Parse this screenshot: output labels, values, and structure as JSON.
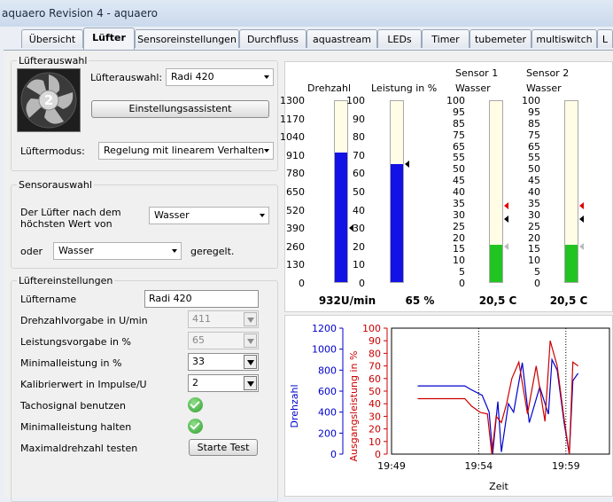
{
  "window": {
    "title": "aquaero Revision 4 -  aquaero"
  },
  "tabs": [
    {
      "label": "Übersicht"
    },
    {
      "label": "Lüfter"
    },
    {
      "label": "Sensoreinstellungen"
    },
    {
      "label": "Durchfluss"
    },
    {
      "label": "aquastream"
    },
    {
      "label": "LEDs"
    },
    {
      "label": "Timer"
    },
    {
      "label": "tubemeter"
    },
    {
      "label": "multiswitch"
    },
    {
      "label": "L"
    }
  ],
  "fan_select": {
    "title": "Lüfterauswahl",
    "fan_number": "2",
    "select_label": "Lüfterauswahl:",
    "select_value": "Radi 420",
    "wizard_button": "Einstellungsassistent",
    "mode_label": "Lüftermodus:",
    "mode_value": "Regelung mit linearem Verhalten"
  },
  "sensor_select": {
    "title": "Sensorauswahl",
    "label_line1": "Der Lüfter nach dem",
    "label_line2": "höchsten Wert von",
    "sensor1_value": "Wasser",
    "or_label": "oder",
    "sensor2_value": "Wasser",
    "suffix": "geregelt."
  },
  "fan_settings": {
    "title": "Lüftereinstellungen",
    "name_label": "Lüftername",
    "name_value": "Radi 420",
    "rpm_label": "Drehzahlvorgabe in U/min",
    "rpm_value": "411",
    "power_label": "Leistungsvorgabe in %",
    "power_value": "65",
    "minpower_label": "Minimalleistung in %",
    "minpower_value": "33",
    "calib_label": "Kalibrierwert in Impulse/U",
    "calib_value": "2",
    "tacho_label": "Tachosignal benutzen",
    "minhold_label": "Minimalleistung halten",
    "maxtest_label": "Maximaldrehzahl testen",
    "maxtest_button": "Starte Test"
  },
  "gauges": [
    {
      "title": "Drehzahl",
      "scale": [
        "1300",
        "1170",
        "1040",
        "910",
        "780",
        "650",
        "520",
        "390",
        "260",
        "130",
        "0"
      ],
      "min": 0,
      "max": 1300,
      "fill": 932,
      "pointer": 390,
      "fill_color": "#1212e6",
      "value": "932U/min"
    },
    {
      "title": "Leistung in %",
      "scale": [
        "100",
        "90",
        "80",
        "70",
        "60",
        "50",
        "40",
        "30",
        "20",
        "10",
        "0"
      ],
      "min": 0,
      "max": 100,
      "fill": 65,
      "pointer": 65,
      "fill_color": "#1212e6",
      "value": "65 %"
    },
    {
      "title": "Sensor 1",
      "title2": "Wasser",
      "scale": [
        "100",
        "95",
        "85",
        "75",
        "65",
        "55",
        "50",
        "45",
        "40",
        "35",
        "30",
        "25",
        "20",
        "15",
        "10",
        "5",
        "0"
      ],
      "min": 0,
      "max": 100,
      "fill": 20.5,
      "pointer": 35,
      "pointer_red": 42,
      "pointer_gray": 20,
      "fill_color": "#22c422",
      "value": "20,5 C"
    },
    {
      "title": "Sensor 2",
      "title2": "Wasser",
      "scale": [
        "100",
        "95",
        "85",
        "75",
        "65",
        "55",
        "50",
        "45",
        "40",
        "35",
        "30",
        "25",
        "20",
        "15",
        "10",
        "5",
        "0"
      ],
      "min": 0,
      "max": 100,
      "fill": 20.5,
      "pointer": 35,
      "pointer_red": 42,
      "pointer_gray": 20,
      "fill_color": "#22c422",
      "value": "20,5 C"
    }
  ],
  "chart_data": {
    "type": "line",
    "xlabel": "Zeit",
    "ylabel": "Drehzahl",
    "ylabel_right": "Ausgangsleistung in %",
    "x_ticks": [
      "19:49",
      "19:54",
      "19:59"
    ],
    "y_ticks": [
      0,
      200,
      400,
      600,
      800,
      1000,
      1200
    ],
    "y_ticks_right": [
      0,
      10,
      20,
      30,
      40,
      50,
      60,
      70,
      80,
      90,
      100
    ],
    "ylim": [
      0,
      1200
    ],
    "ylim_right": [
      0,
      100
    ],
    "xlim": [
      0,
      12.5
    ],
    "x_tick_values": [
      0,
      5,
      10
    ],
    "grid": "vertical-dotted",
    "series": [
      {
        "axis": "left",
        "color": "#0000cc",
        "x": [
          1.5,
          4.2,
          4.5,
          5.2,
          5.6,
          5.8,
          6.1,
          6.3,
          6.7,
          7.0,
          7.5,
          7.9,
          8.5,
          9.0,
          9.2,
          9.5,
          9.9,
          10.2,
          10.4,
          10.7
        ],
        "y": [
          650,
          650,
          620,
          560,
          400,
          0,
          500,
          20,
          480,
          400,
          870,
          300,
          640,
          380,
          900,
          800,
          300,
          0,
          700,
          770
        ]
      },
      {
        "axis": "right",
        "color": "#cc0000",
        "x": [
          1.5,
          4.2,
          4.6,
          5.1,
          5.5,
          5.75,
          6.0,
          6.3,
          6.6,
          6.9,
          7.3,
          7.8,
          8.3,
          8.8,
          9.1,
          9.5,
          9.9,
          10.2,
          10.4,
          10.7
        ],
        "y": [
          44,
          44,
          38,
          33,
          32,
          0,
          30,
          25,
          40,
          60,
          73,
          32,
          70,
          26,
          90,
          70,
          28,
          0,
          73,
          70
        ]
      }
    ]
  }
}
